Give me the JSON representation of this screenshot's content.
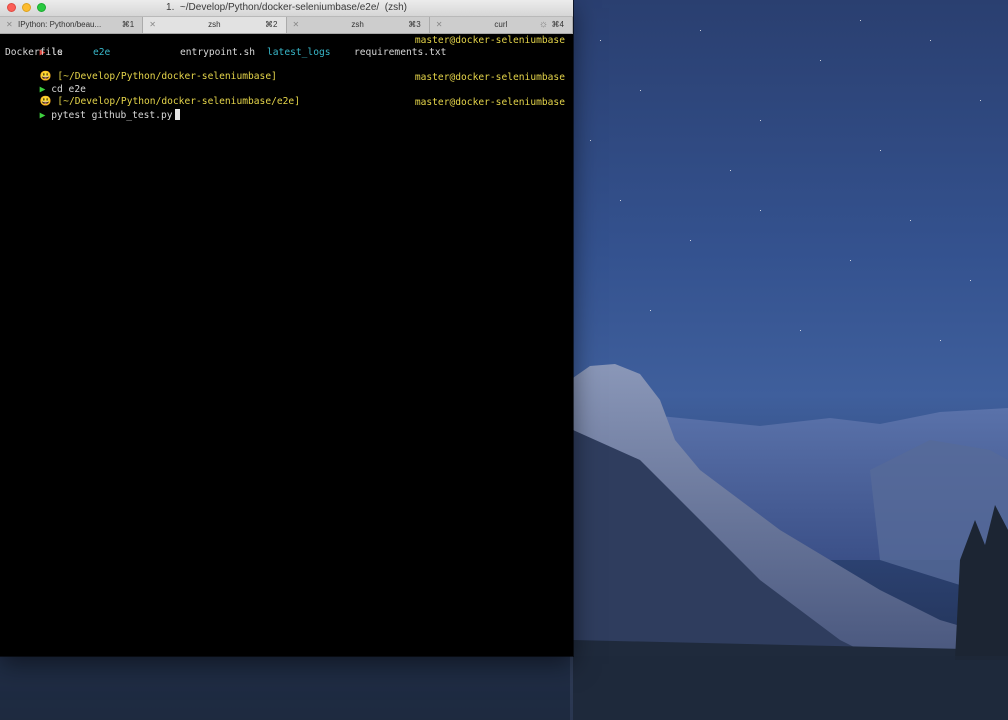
{
  "window": {
    "title": "1.  ~/Develop/Python/docker-seleniumbase/e2e/  (zsh)"
  },
  "tabs": [
    {
      "close": "✕",
      "label": "IPython: Python/beau...",
      "shortcut": "⌘1"
    },
    {
      "close": "✕",
      "label": "zsh",
      "shortcut": "⌘2"
    },
    {
      "close": "✕",
      "label": "zsh",
      "shortcut": "⌘3"
    },
    {
      "close": "✕",
      "label": "curl",
      "shortcut": "⌘4",
      "spinner": "☼"
    }
  ],
  "terminal": {
    "prompt_host": "master@docker-seleniumbase",
    "line1": {
      "arrow": "▶",
      "cmd": "ls"
    },
    "ls_output": [
      "Dockerfile",
      "e2e",
      "entrypoint.sh",
      "latest_logs",
      "requirements.txt"
    ],
    "line3": {
      "emoji": "😃",
      "path": "[~/Develop/Python/docker-seleniumbase]"
    },
    "line4": {
      "arrow": "▶",
      "cmd": "cd e2e"
    },
    "line5": {
      "emoji": "😃",
      "path": "[~/Develop/Python/docker-seleniumbase/e2e]"
    },
    "line6": {
      "arrow": "▶",
      "cmd": "pytest github_test.py"
    }
  },
  "colors": {
    "error_arrow": "#e0473f",
    "ok_arrow": "#3ed13e",
    "prompt_yellow": "#e4d44a",
    "dir_cyan": "#38b7c9"
  }
}
